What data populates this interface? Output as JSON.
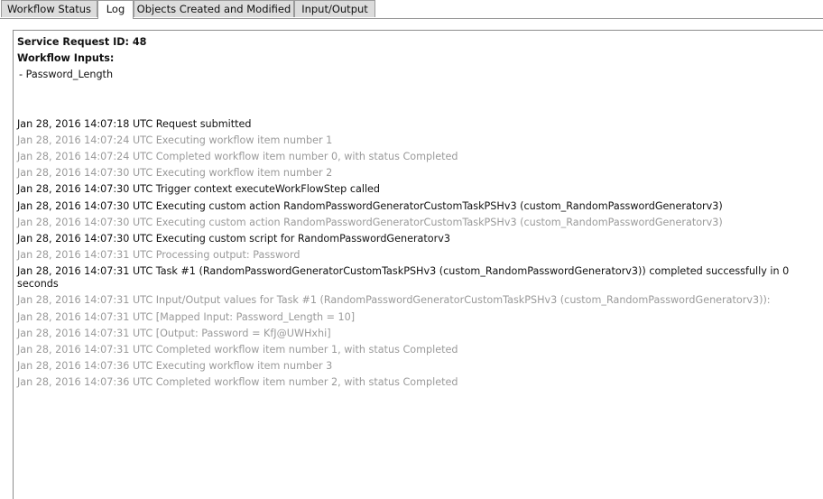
{
  "tabs": [
    {
      "label": "Workflow Status",
      "active": false
    },
    {
      "label": "Log",
      "active": true
    },
    {
      "label": "Objects Created and Modified",
      "active": false
    },
    {
      "label": "Input/Output",
      "active": false
    }
  ],
  "log": {
    "service_request": "Service Request ID: 48",
    "workflow_inputs_heading": "Workflow Inputs:",
    "inputs": [
      " - Password_Length"
    ],
    "lines": [
      {
        "text": "Jan 28, 2016 14:07:18 UTC Request submitted",
        "dim": false
      },
      {
        "text": "Jan 28, 2016 14:07:24 UTC Executing workflow item number 1",
        "dim": true
      },
      {
        "text": "Jan 28, 2016 14:07:24 UTC Completed workflow item number 0, with status Completed",
        "dim": true
      },
      {
        "text": "Jan 28, 2016 14:07:30 UTC Executing workflow item number 2",
        "dim": true
      },
      {
        "text": "Jan 28, 2016 14:07:30 UTC Trigger context executeWorkFlowStep called",
        "dim": false
      },
      {
        "text": "Jan 28, 2016 14:07:30 UTC Executing custom action RandomPasswordGeneratorCustomTaskPSHv3 (custom_RandomPasswordGeneratorv3)",
        "dim": false
      },
      {
        "text": "Jan 28, 2016 14:07:30 UTC Executing custom action RandomPasswordGeneratorCustomTaskPSHv3 (custom_RandomPasswordGeneratorv3)",
        "dim": true
      },
      {
        "text": "Jan 28, 2016 14:07:30 UTC Executing custom script for RandomPasswordGeneratorv3",
        "dim": false
      },
      {
        "text": "Jan 28, 2016 14:07:31 UTC Processing output: Password",
        "dim": true
      },
      {
        "text": "Jan 28, 2016 14:07:31 UTC Task #1 (RandomPasswordGeneratorCustomTaskPSHv3 (custom_RandomPasswordGeneratorv3)) completed successfully in 0 seconds",
        "dim": false
      },
      {
        "text": "Jan 28, 2016 14:07:31 UTC Input/Output values for Task #1 (RandomPasswordGeneratorCustomTaskPSHv3 (custom_RandomPasswordGeneratorv3)):",
        "dim": true
      },
      {
        "text": "Jan 28, 2016 14:07:31 UTC [Mapped Input: Password_Length = 10]",
        "dim": true
      },
      {
        "text": "Jan 28, 2016 14:07:31 UTC [Output: Password = KfJ@UWHxhi]",
        "dim": true
      },
      {
        "text": "Jan 28, 2016 14:07:31 UTC Completed workflow item number 1, with status Completed",
        "dim": true
      },
      {
        "text": "Jan 28, 2016 14:07:36 UTC Executing workflow item number 3",
        "dim": true
      },
      {
        "text": "Jan 28, 2016 14:07:36 UTC Completed workflow item number 2, with status Completed",
        "dim": true
      }
    ]
  }
}
